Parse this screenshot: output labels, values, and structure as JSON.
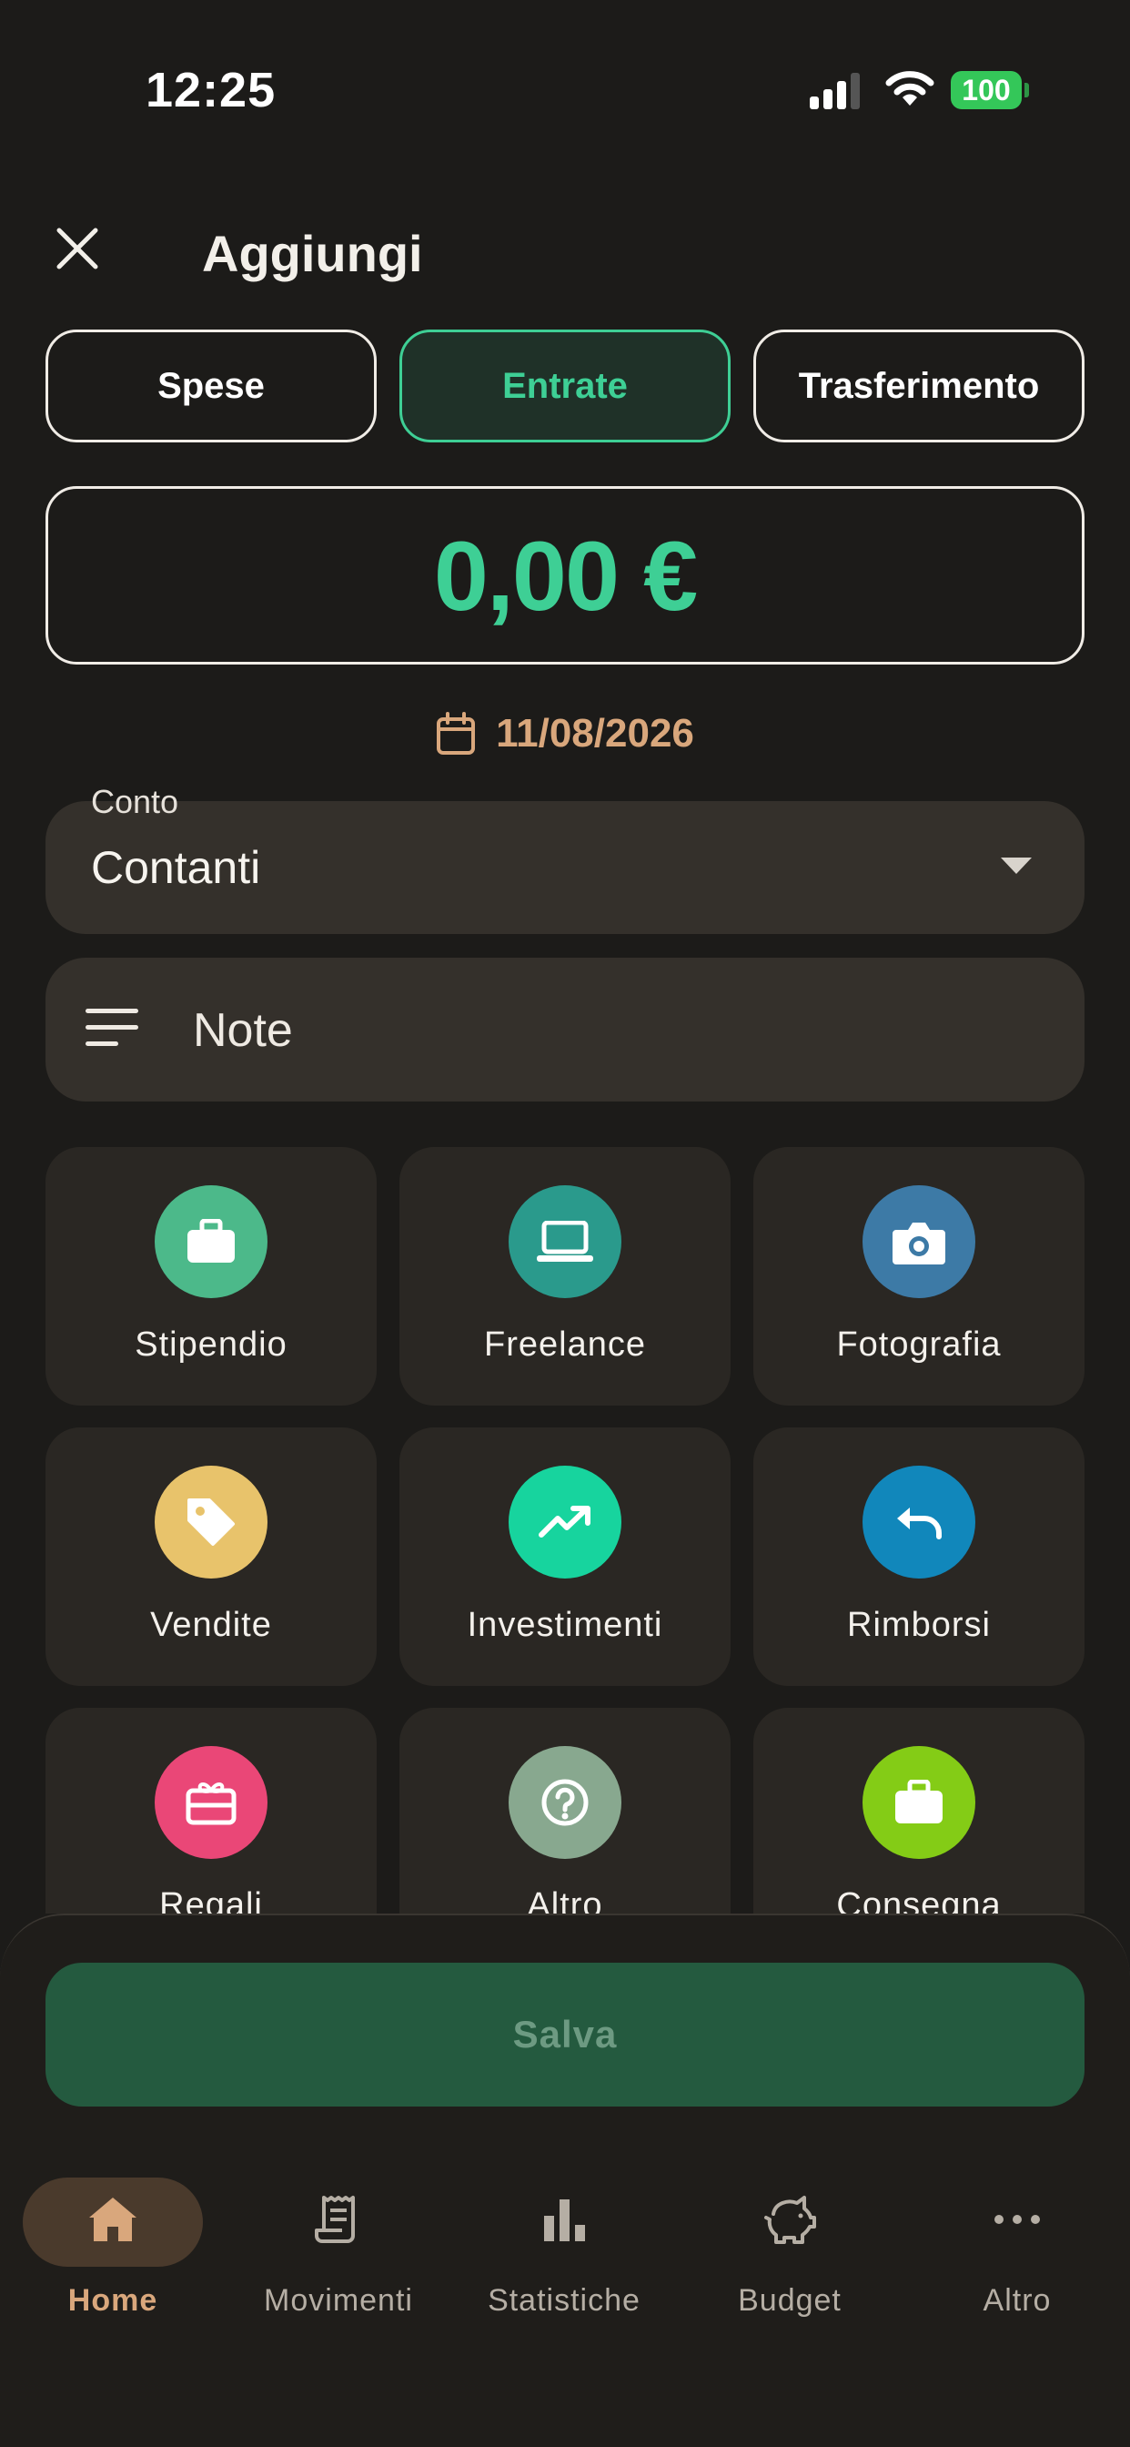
{
  "status_bar": {
    "time": "12:25",
    "battery": "100"
  },
  "header": {
    "title": "Aggiungi",
    "close_icon": "close-icon"
  },
  "type_tabs": [
    {
      "label": "Spese",
      "active": false
    },
    {
      "label": "Entrate",
      "active": true
    },
    {
      "label": "Trasferimento",
      "active": false
    }
  ],
  "amount": {
    "value": "0,00 €"
  },
  "date": {
    "value": "11/08/2026",
    "icon": "calendar-icon"
  },
  "account": {
    "label": "Conto",
    "value": "Contanti"
  },
  "note": {
    "placeholder": "Note",
    "icon": "notes-icon"
  },
  "categories": [
    {
      "label": "Stipendio",
      "icon": "briefcase-icon",
      "color": "#4cb98a"
    },
    {
      "label": "Freelance",
      "icon": "laptop-icon",
      "color": "#2a9a8c"
    },
    {
      "label": "Fotografia",
      "icon": "camera-icon",
      "color": "#3d7aa6"
    },
    {
      "label": "Vendite",
      "icon": "tag-icon",
      "color": "#e8c36b"
    },
    {
      "label": "Investimenti",
      "icon": "trending-up-icon",
      "color": "#17d49e"
    },
    {
      "label": "Rimborsi",
      "icon": "undo-icon",
      "color": "#1187bb"
    },
    {
      "label": "Regali",
      "icon": "gift-card-icon",
      "color": "#ea4777"
    },
    {
      "label": "Altro",
      "icon": "help-circle-icon",
      "color": "#88a88f"
    },
    {
      "label": "Consegna",
      "icon": "briefcase-icon",
      "color": "#84cc16"
    }
  ],
  "save_button": {
    "label": "Salva"
  },
  "colors": {
    "accent_green": "#3ecf95",
    "accent_orange": "#d9a77c",
    "background": "#1c1b19",
    "surface": "#34302b"
  },
  "nav": [
    {
      "label": "Home",
      "icon": "home-icon",
      "active": true
    },
    {
      "label": "Movimenti",
      "icon": "receipt-icon",
      "active": false
    },
    {
      "label": "Statistiche",
      "icon": "bar-chart-icon",
      "active": false
    },
    {
      "label": "Budget",
      "icon": "piggy-bank-icon",
      "active": false
    },
    {
      "label": "Altro",
      "icon": "more-horizontal-icon",
      "active": false
    }
  ]
}
